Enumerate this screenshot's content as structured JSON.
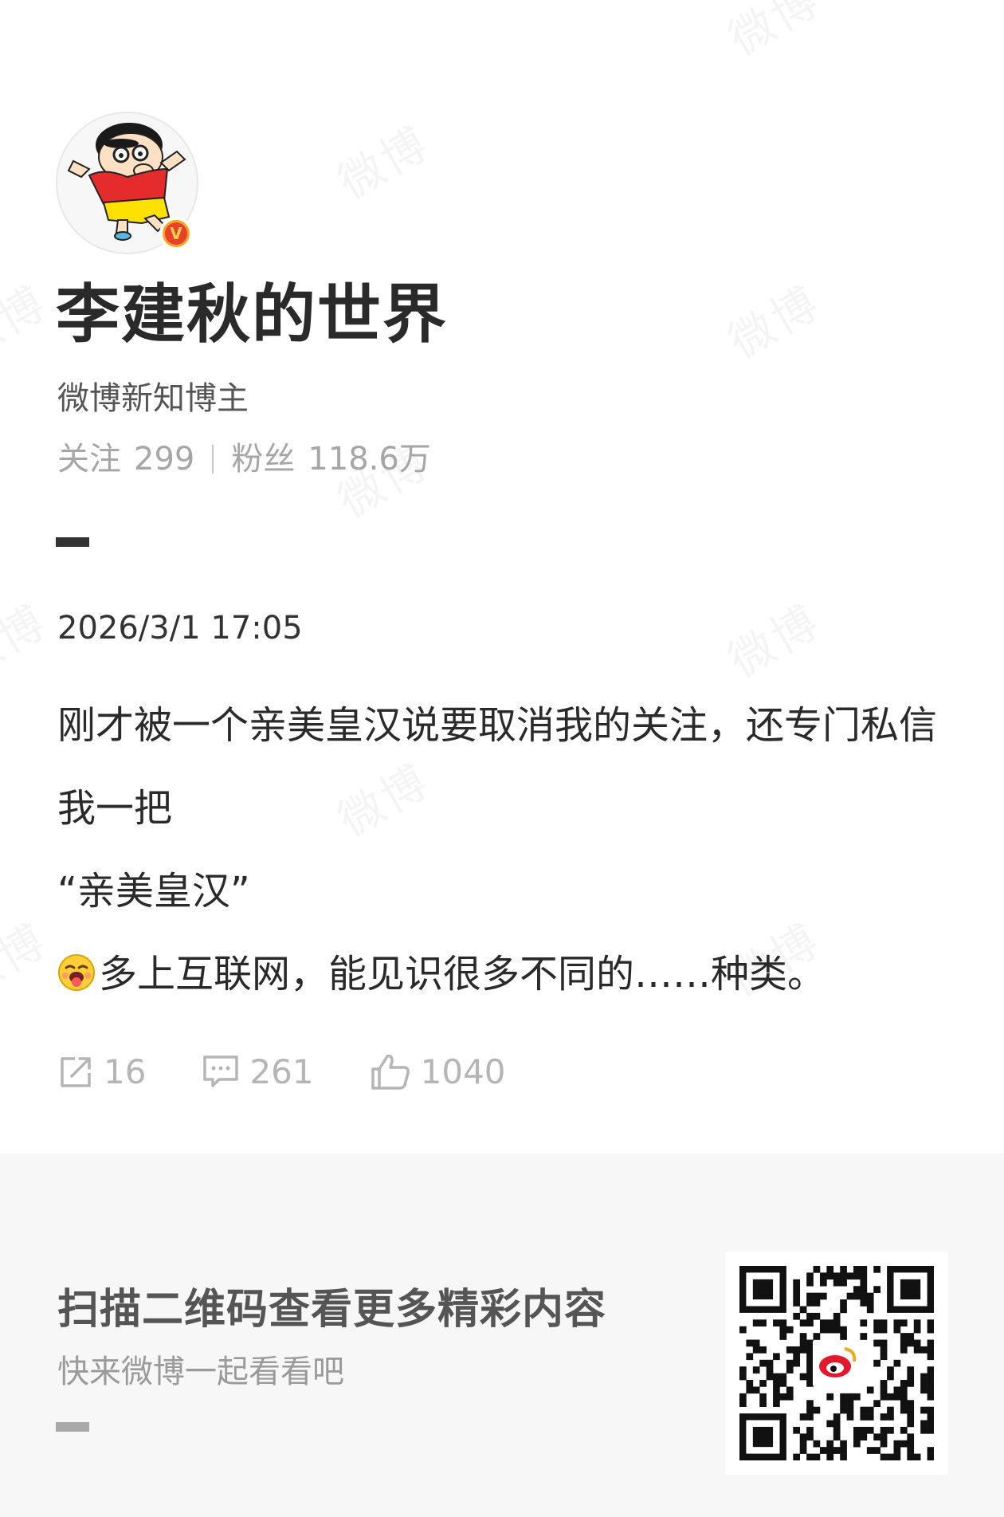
{
  "watermark_text": "微博",
  "profile": {
    "name": "李建秋的世界",
    "title": "微博新知博主",
    "verified_mark": "V",
    "following_label": "关注",
    "following_count": "299",
    "followers_label": "粉丝",
    "followers_count": "118.6万",
    "avatar_icon": "crayon-shinchan-avatar"
  },
  "post": {
    "timestamp": "2026/3/1 17:05",
    "line1": "刚才被一个亲美皇汉说要取消我的关注，还专门私信我一把",
    "line2": "“亲美皇汉”",
    "line3": "多上互联网，能见识很多不同的……种类。",
    "emoji_icon": "laughing-tongue-emoji"
  },
  "actions": {
    "repost_count": "16",
    "comment_count": "261",
    "like_count": "1040"
  },
  "footer": {
    "title": "扫描二维码查看更多精彩内容",
    "subtitle": "快来微博一起看看吧"
  },
  "colors": {
    "accent_badge": "#f5a623",
    "footer_bg": "#f7f7f7",
    "muted_text": "#a6a6a6"
  }
}
